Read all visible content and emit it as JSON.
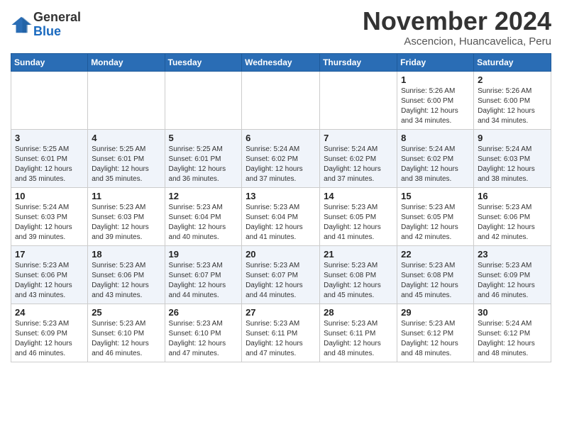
{
  "header": {
    "logo": {
      "general": "General",
      "blue": "Blue"
    },
    "title": "November 2024",
    "location": "Ascencion, Huancavelica, Peru"
  },
  "weekdays": [
    "Sunday",
    "Monday",
    "Tuesday",
    "Wednesday",
    "Thursday",
    "Friday",
    "Saturday"
  ],
  "weeks": [
    [
      {
        "day": "",
        "info": ""
      },
      {
        "day": "",
        "info": ""
      },
      {
        "day": "",
        "info": ""
      },
      {
        "day": "",
        "info": ""
      },
      {
        "day": "",
        "info": ""
      },
      {
        "day": "1",
        "info": "Sunrise: 5:26 AM\nSunset: 6:00 PM\nDaylight: 12 hours and 34 minutes."
      },
      {
        "day": "2",
        "info": "Sunrise: 5:26 AM\nSunset: 6:00 PM\nDaylight: 12 hours and 34 minutes."
      }
    ],
    [
      {
        "day": "3",
        "info": "Sunrise: 5:25 AM\nSunset: 6:01 PM\nDaylight: 12 hours and 35 minutes."
      },
      {
        "day": "4",
        "info": "Sunrise: 5:25 AM\nSunset: 6:01 PM\nDaylight: 12 hours and 35 minutes."
      },
      {
        "day": "5",
        "info": "Sunrise: 5:25 AM\nSunset: 6:01 PM\nDaylight: 12 hours and 36 minutes."
      },
      {
        "day": "6",
        "info": "Sunrise: 5:24 AM\nSunset: 6:02 PM\nDaylight: 12 hours and 37 minutes."
      },
      {
        "day": "7",
        "info": "Sunrise: 5:24 AM\nSunset: 6:02 PM\nDaylight: 12 hours and 37 minutes."
      },
      {
        "day": "8",
        "info": "Sunrise: 5:24 AM\nSunset: 6:02 PM\nDaylight: 12 hours and 38 minutes."
      },
      {
        "day": "9",
        "info": "Sunrise: 5:24 AM\nSunset: 6:03 PM\nDaylight: 12 hours and 38 minutes."
      }
    ],
    [
      {
        "day": "10",
        "info": "Sunrise: 5:24 AM\nSunset: 6:03 PM\nDaylight: 12 hours and 39 minutes."
      },
      {
        "day": "11",
        "info": "Sunrise: 5:23 AM\nSunset: 6:03 PM\nDaylight: 12 hours and 39 minutes."
      },
      {
        "day": "12",
        "info": "Sunrise: 5:23 AM\nSunset: 6:04 PM\nDaylight: 12 hours and 40 minutes."
      },
      {
        "day": "13",
        "info": "Sunrise: 5:23 AM\nSunset: 6:04 PM\nDaylight: 12 hours and 41 minutes."
      },
      {
        "day": "14",
        "info": "Sunrise: 5:23 AM\nSunset: 6:05 PM\nDaylight: 12 hours and 41 minutes."
      },
      {
        "day": "15",
        "info": "Sunrise: 5:23 AM\nSunset: 6:05 PM\nDaylight: 12 hours and 42 minutes."
      },
      {
        "day": "16",
        "info": "Sunrise: 5:23 AM\nSunset: 6:06 PM\nDaylight: 12 hours and 42 minutes."
      }
    ],
    [
      {
        "day": "17",
        "info": "Sunrise: 5:23 AM\nSunset: 6:06 PM\nDaylight: 12 hours and 43 minutes."
      },
      {
        "day": "18",
        "info": "Sunrise: 5:23 AM\nSunset: 6:06 PM\nDaylight: 12 hours and 43 minutes."
      },
      {
        "day": "19",
        "info": "Sunrise: 5:23 AM\nSunset: 6:07 PM\nDaylight: 12 hours and 44 minutes."
      },
      {
        "day": "20",
        "info": "Sunrise: 5:23 AM\nSunset: 6:07 PM\nDaylight: 12 hours and 44 minutes."
      },
      {
        "day": "21",
        "info": "Sunrise: 5:23 AM\nSunset: 6:08 PM\nDaylight: 12 hours and 45 minutes."
      },
      {
        "day": "22",
        "info": "Sunrise: 5:23 AM\nSunset: 6:08 PM\nDaylight: 12 hours and 45 minutes."
      },
      {
        "day": "23",
        "info": "Sunrise: 5:23 AM\nSunset: 6:09 PM\nDaylight: 12 hours and 46 minutes."
      }
    ],
    [
      {
        "day": "24",
        "info": "Sunrise: 5:23 AM\nSunset: 6:09 PM\nDaylight: 12 hours and 46 minutes."
      },
      {
        "day": "25",
        "info": "Sunrise: 5:23 AM\nSunset: 6:10 PM\nDaylight: 12 hours and 46 minutes."
      },
      {
        "day": "26",
        "info": "Sunrise: 5:23 AM\nSunset: 6:10 PM\nDaylight: 12 hours and 47 minutes."
      },
      {
        "day": "27",
        "info": "Sunrise: 5:23 AM\nSunset: 6:11 PM\nDaylight: 12 hours and 47 minutes."
      },
      {
        "day": "28",
        "info": "Sunrise: 5:23 AM\nSunset: 6:11 PM\nDaylight: 12 hours and 48 minutes."
      },
      {
        "day": "29",
        "info": "Sunrise: 5:23 AM\nSunset: 6:12 PM\nDaylight: 12 hours and 48 minutes."
      },
      {
        "day": "30",
        "info": "Sunrise: 5:24 AM\nSunset: 6:12 PM\nDaylight: 12 hours and 48 minutes."
      }
    ]
  ]
}
